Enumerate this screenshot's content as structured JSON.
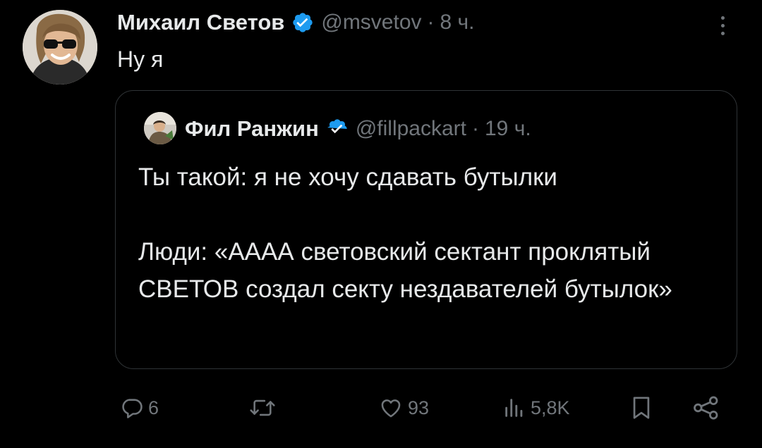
{
  "tweet": {
    "author_name": "Михаил Светов",
    "handle": "@msvetov",
    "separator": "·",
    "time": "8 ч.",
    "text": "Ну я",
    "avatar_icon": "user-avatar-photo",
    "verified_icon": "verified-badge-icon",
    "more_icon": "more-options-icon"
  },
  "quote": {
    "author_name": "Фил Ранжин",
    "handle": "@fillpackart",
    "separator": "·",
    "time": "19 ч.",
    "paragraphs": [
      "Ты такой: я не хочу сдавать бутылки",
      "Люди: «АААА световский сектант проклятый СВЕТОВ создал секту нездавателей бутылок»"
    ]
  },
  "actions": {
    "reply_count": "6",
    "retweet_count": "",
    "like_count": "93",
    "views_count": "5,8K"
  },
  "colors": {
    "background": "#000000",
    "text": "#e7e9ea",
    "muted": "#71767b",
    "border": "#2f3336",
    "verified": "#1d9bf0"
  }
}
